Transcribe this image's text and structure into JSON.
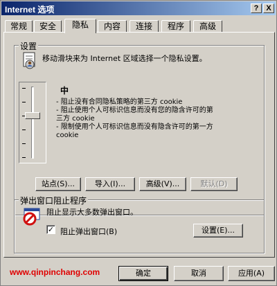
{
  "window": {
    "title": "Internet 选项",
    "help_label": "?",
    "close_label": "X"
  },
  "tabs": [
    {
      "label": "常规"
    },
    {
      "label": "安全"
    },
    {
      "label": "隐私"
    },
    {
      "label": "内容"
    },
    {
      "label": "连接"
    },
    {
      "label": "程序"
    },
    {
      "label": "高级"
    }
  ],
  "settings": {
    "group_label": "设置",
    "description": "移动滑块来为 Internet 区域选择一个隐私设置。",
    "level_title": "中",
    "level_lines": [
      "- 阻止没有合同隐私策略的第三方 cookie",
      "- 阻止使用个人可标识信息而没有您的隐含许可的第",
      "三方 cookie",
      "- 限制使用个人可标识信息而没有隐含许可的第一方",
      "cookie"
    ],
    "slider_level": 2,
    "slider_levels": 6,
    "buttons": {
      "sites": "站点(S)...",
      "import": "导入(I)...",
      "advanced": "高级(V)...",
      "default": "默认(D)"
    }
  },
  "popup": {
    "group_label": "弹出窗口阻止程序",
    "description": "阻止显示大多数弹出窗口。",
    "checkbox_label": "阻止弹出窗口(B)",
    "checkbox_checked": true,
    "checkbox_mark": "✓",
    "settings_button": "设置(E)..."
  },
  "footer": {
    "watermark": "www.qinpinchang.com",
    "ok": "确定",
    "cancel": "取消",
    "apply": "应用(A)"
  }
}
